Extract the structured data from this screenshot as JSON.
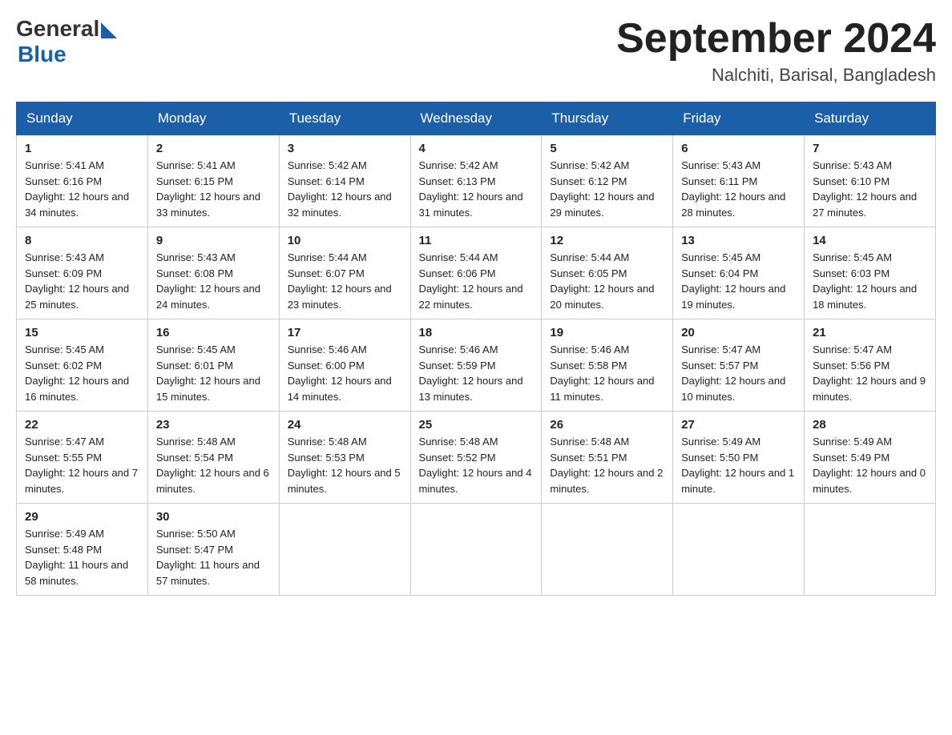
{
  "header": {
    "logo_general": "General",
    "logo_blue": "Blue",
    "month_title": "September 2024",
    "location": "Nalchiti, Barisal, Bangladesh"
  },
  "weekdays": [
    "Sunday",
    "Monday",
    "Tuesday",
    "Wednesday",
    "Thursday",
    "Friday",
    "Saturday"
  ],
  "weeks": [
    [
      {
        "day": "1",
        "sunrise": "5:41 AM",
        "sunset": "6:16 PM",
        "daylight": "12 hours and 34 minutes."
      },
      {
        "day": "2",
        "sunrise": "5:41 AM",
        "sunset": "6:15 PM",
        "daylight": "12 hours and 33 minutes."
      },
      {
        "day": "3",
        "sunrise": "5:42 AM",
        "sunset": "6:14 PM",
        "daylight": "12 hours and 32 minutes."
      },
      {
        "day": "4",
        "sunrise": "5:42 AM",
        "sunset": "6:13 PM",
        "daylight": "12 hours and 31 minutes."
      },
      {
        "day": "5",
        "sunrise": "5:42 AM",
        "sunset": "6:12 PM",
        "daylight": "12 hours and 29 minutes."
      },
      {
        "day": "6",
        "sunrise": "5:43 AM",
        "sunset": "6:11 PM",
        "daylight": "12 hours and 28 minutes."
      },
      {
        "day": "7",
        "sunrise": "5:43 AM",
        "sunset": "6:10 PM",
        "daylight": "12 hours and 27 minutes."
      }
    ],
    [
      {
        "day": "8",
        "sunrise": "5:43 AM",
        "sunset": "6:09 PM",
        "daylight": "12 hours and 25 minutes."
      },
      {
        "day": "9",
        "sunrise": "5:43 AM",
        "sunset": "6:08 PM",
        "daylight": "12 hours and 24 minutes."
      },
      {
        "day": "10",
        "sunrise": "5:44 AM",
        "sunset": "6:07 PM",
        "daylight": "12 hours and 23 minutes."
      },
      {
        "day": "11",
        "sunrise": "5:44 AM",
        "sunset": "6:06 PM",
        "daylight": "12 hours and 22 minutes."
      },
      {
        "day": "12",
        "sunrise": "5:44 AM",
        "sunset": "6:05 PM",
        "daylight": "12 hours and 20 minutes."
      },
      {
        "day": "13",
        "sunrise": "5:45 AM",
        "sunset": "6:04 PM",
        "daylight": "12 hours and 19 minutes."
      },
      {
        "day": "14",
        "sunrise": "5:45 AM",
        "sunset": "6:03 PM",
        "daylight": "12 hours and 18 minutes."
      }
    ],
    [
      {
        "day": "15",
        "sunrise": "5:45 AM",
        "sunset": "6:02 PM",
        "daylight": "12 hours and 16 minutes."
      },
      {
        "day": "16",
        "sunrise": "5:45 AM",
        "sunset": "6:01 PM",
        "daylight": "12 hours and 15 minutes."
      },
      {
        "day": "17",
        "sunrise": "5:46 AM",
        "sunset": "6:00 PM",
        "daylight": "12 hours and 14 minutes."
      },
      {
        "day": "18",
        "sunrise": "5:46 AM",
        "sunset": "5:59 PM",
        "daylight": "12 hours and 13 minutes."
      },
      {
        "day": "19",
        "sunrise": "5:46 AM",
        "sunset": "5:58 PM",
        "daylight": "12 hours and 11 minutes."
      },
      {
        "day": "20",
        "sunrise": "5:47 AM",
        "sunset": "5:57 PM",
        "daylight": "12 hours and 10 minutes."
      },
      {
        "day": "21",
        "sunrise": "5:47 AM",
        "sunset": "5:56 PM",
        "daylight": "12 hours and 9 minutes."
      }
    ],
    [
      {
        "day": "22",
        "sunrise": "5:47 AM",
        "sunset": "5:55 PM",
        "daylight": "12 hours and 7 minutes."
      },
      {
        "day": "23",
        "sunrise": "5:48 AM",
        "sunset": "5:54 PM",
        "daylight": "12 hours and 6 minutes."
      },
      {
        "day": "24",
        "sunrise": "5:48 AM",
        "sunset": "5:53 PM",
        "daylight": "12 hours and 5 minutes."
      },
      {
        "day": "25",
        "sunrise": "5:48 AM",
        "sunset": "5:52 PM",
        "daylight": "12 hours and 4 minutes."
      },
      {
        "day": "26",
        "sunrise": "5:48 AM",
        "sunset": "5:51 PM",
        "daylight": "12 hours and 2 minutes."
      },
      {
        "day": "27",
        "sunrise": "5:49 AM",
        "sunset": "5:50 PM",
        "daylight": "12 hours and 1 minute."
      },
      {
        "day": "28",
        "sunrise": "5:49 AM",
        "sunset": "5:49 PM",
        "daylight": "12 hours and 0 minutes."
      }
    ],
    [
      {
        "day": "29",
        "sunrise": "5:49 AM",
        "sunset": "5:48 PM",
        "daylight": "11 hours and 58 minutes."
      },
      {
        "day": "30",
        "sunrise": "5:50 AM",
        "sunset": "5:47 PM",
        "daylight": "11 hours and 57 minutes."
      },
      null,
      null,
      null,
      null,
      null
    ]
  ],
  "labels": {
    "sunrise": "Sunrise: ",
    "sunset": "Sunset: ",
    "daylight": "Daylight: "
  }
}
